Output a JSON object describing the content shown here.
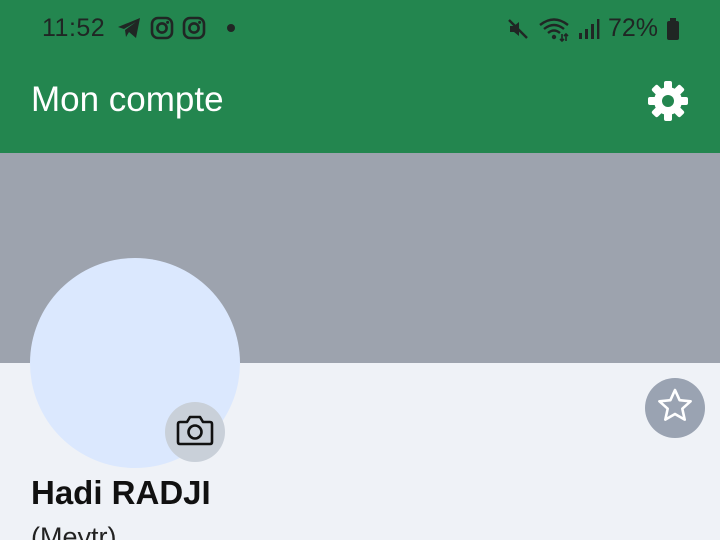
{
  "status_bar": {
    "time": "11:52",
    "notification_icons": [
      "telegram-icon",
      "instagram-icon",
      "instagram-icon",
      "dot-icon"
    ],
    "system_icons": [
      "mute-icon",
      "wifi-icon",
      "signal-icon",
      "battery-icon"
    ],
    "battery_text": "72%"
  },
  "app_bar": {
    "title": "Mon compte",
    "settings_icon": "gear-icon",
    "background_color": "#23864f"
  },
  "profile": {
    "cover_color": "#9da3ae",
    "avatar_color": "#dbe8fe",
    "camera_icon": "camera-icon",
    "favorite_icon": "star-icon",
    "name": "Hadi RADJI",
    "role": "(Meytr)"
  }
}
